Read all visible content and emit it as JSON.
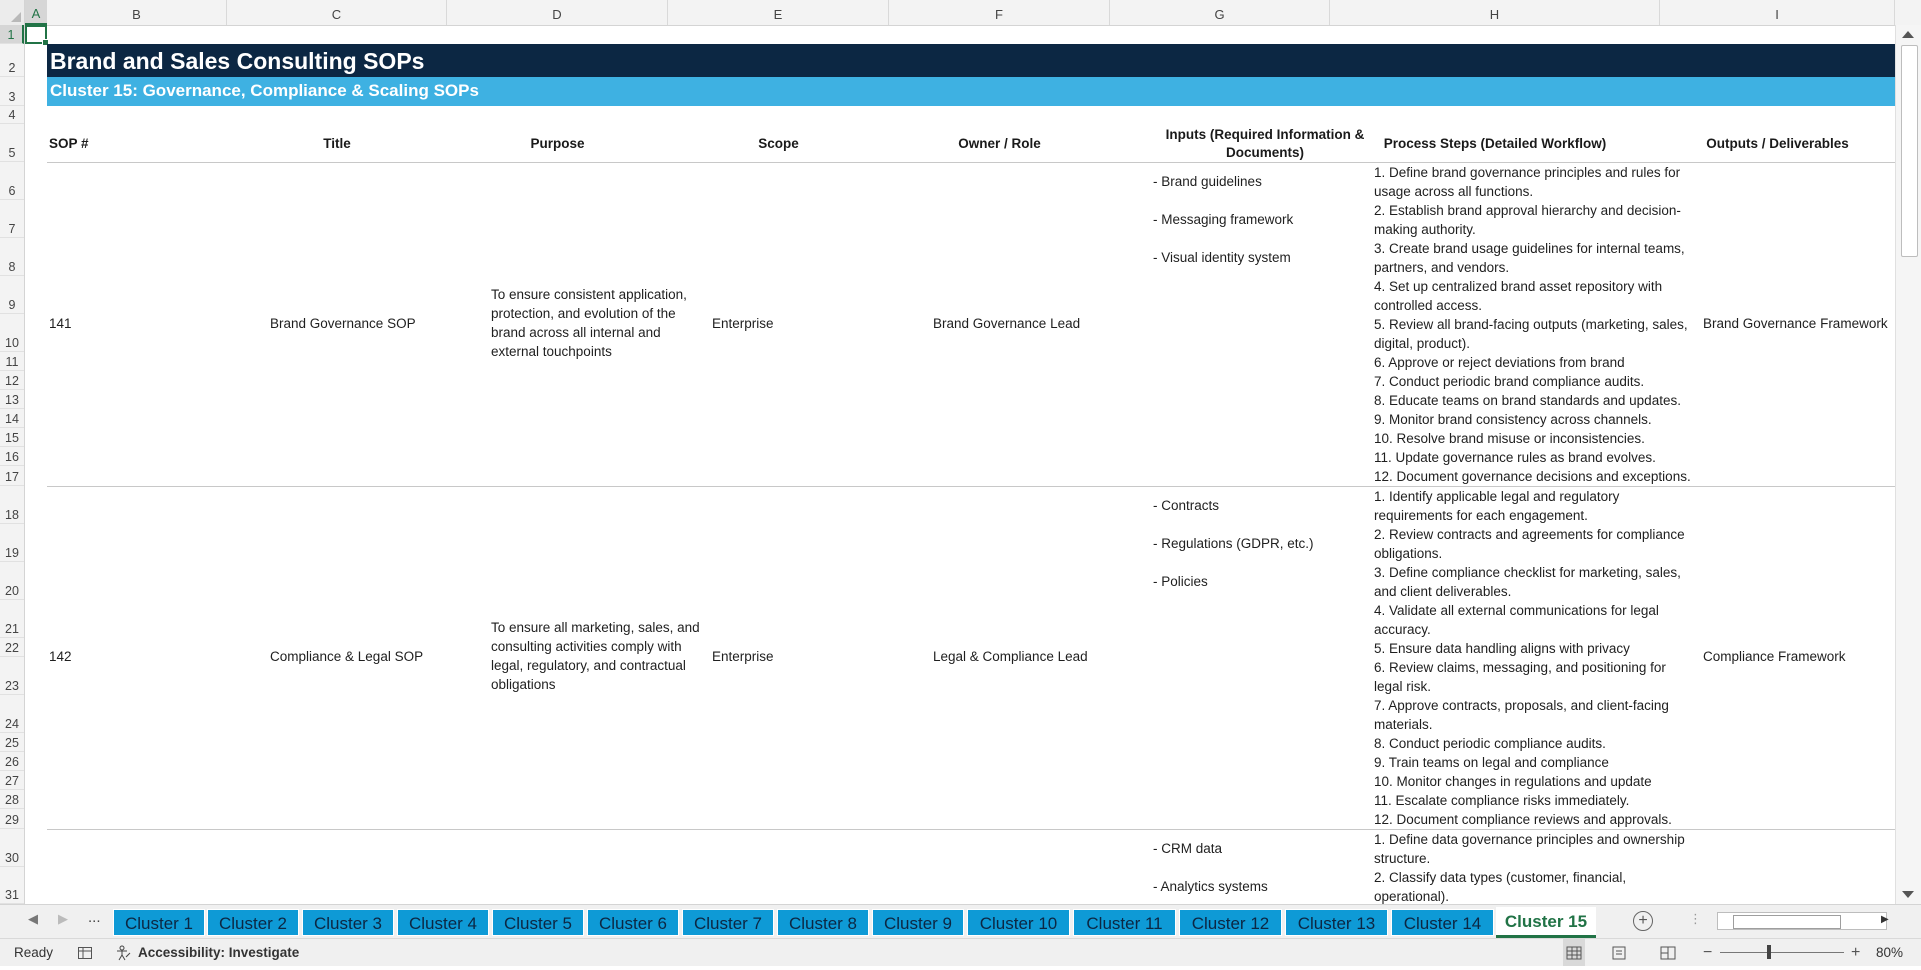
{
  "columns": [
    "A",
    "B",
    "C",
    "D",
    "E",
    "F",
    "G",
    "H",
    "I"
  ],
  "rows": [
    "1",
    "2",
    "3",
    "4",
    "5",
    "6",
    "7",
    "8",
    "9",
    "10",
    "11",
    "12",
    "13",
    "14",
    "15",
    "16",
    "17",
    "18",
    "19",
    "20",
    "21",
    "22",
    "23",
    "24",
    "25",
    "26",
    "27",
    "28",
    "29",
    "30",
    "31"
  ],
  "sheet": {
    "title": "Brand and Sales Consulting SOPs",
    "subtitle": "Cluster 15: Governance, Compliance & Scaling SOPs",
    "headers": {
      "sop": "SOP #",
      "title": "Title",
      "purpose": "Purpose",
      "scope": "Scope",
      "owner": "Owner / Role",
      "inputs": "Inputs (Required Information & Documents)",
      "steps": "Process Steps (Detailed Workflow)",
      "outputs": "Outputs / Deliverables"
    },
    "records": [
      {
        "sop": "141",
        "title": "Brand Governance SOP",
        "purpose": "To ensure consistent application, protection, and evolution of the brand across all internal and external touchpoints",
        "scope": "Enterprise",
        "owner": "Brand Governance Lead",
        "inputs": [
          "- Brand guidelines",
          "- Messaging framework",
          "- Visual identity system"
        ],
        "steps": [
          "1. Define brand governance principles and rules for usage across all functions.",
          "2. Establish brand approval hierarchy and decision-making authority.",
          "3. Create brand usage guidelines for internal teams, partners, and vendors.",
          "4. Set up centralized brand asset repository with controlled access.",
          "5. Review all brand-facing outputs (marketing, sales, digital, product).",
          "6. Approve or reject deviations from brand",
          "7. Conduct periodic brand compliance audits.",
          "8. Educate teams on brand standards and updates.",
          "9. Monitor brand consistency across channels.",
          "10. Resolve brand misuse or inconsistencies.",
          "11. Update governance rules as brand evolves.",
          "12. Document governance decisions and exceptions."
        ],
        "outputs": "Brand Governance Framework"
      },
      {
        "sop": "142",
        "title": "Compliance & Legal SOP",
        "purpose": "To ensure all marketing, sales, and consulting activities comply with legal, regulatory, and contractual obligations",
        "scope": "Enterprise",
        "owner": "Legal & Compliance Lead",
        "inputs": [
          "- Contracts",
          "- Regulations (GDPR, etc.)",
          "- Policies"
        ],
        "steps": [
          "1. Identify applicable legal and regulatory requirements for each engagement.",
          "2. Review contracts and agreements for compliance obligations.",
          "3. Define compliance checklist for marketing, sales, and client deliverables.",
          "4. Validate all external communications for legal accuracy.",
          "5. Ensure data handling aligns with privacy",
          "6. Review claims, messaging, and positioning for legal risk.",
          "7. Approve contracts, proposals, and client-facing materials.",
          "8. Conduct periodic compliance audits.",
          "9. Train teams on legal and compliance",
          "10. Monitor changes in regulations and update",
          "11. Escalate compliance risks immediately.",
          "12. Document compliance reviews and approvals."
        ],
        "outputs": "Compliance Framework"
      },
      {
        "inputs": [
          "- CRM data",
          "- Analytics systems"
        ],
        "steps": [
          "1. Define data governance principles and ownership structure.",
          "2. Classify data types (customer, financial, operational)."
        ]
      }
    ]
  },
  "tabs": {
    "ellipsis": "...",
    "items": [
      "Cluster 1",
      "Cluster 2",
      "Cluster 3",
      "Cluster 4",
      "Cluster 5",
      "Cluster 6",
      "Cluster 7",
      "Cluster 8",
      "Cluster 9",
      "Cluster 10",
      "Cluster 11",
      "Cluster 12",
      "Cluster 13",
      "Cluster 14"
    ],
    "active": "Cluster 15"
  },
  "status": {
    "ready": "Ready",
    "accessibility": "Accessibility: Investigate",
    "zoom": "80%"
  },
  "colors": {
    "title_band": "#0c2743",
    "subtitle_band": "#3eb1e2",
    "tab": "#0e9ad6",
    "accent": "#217346"
  }
}
